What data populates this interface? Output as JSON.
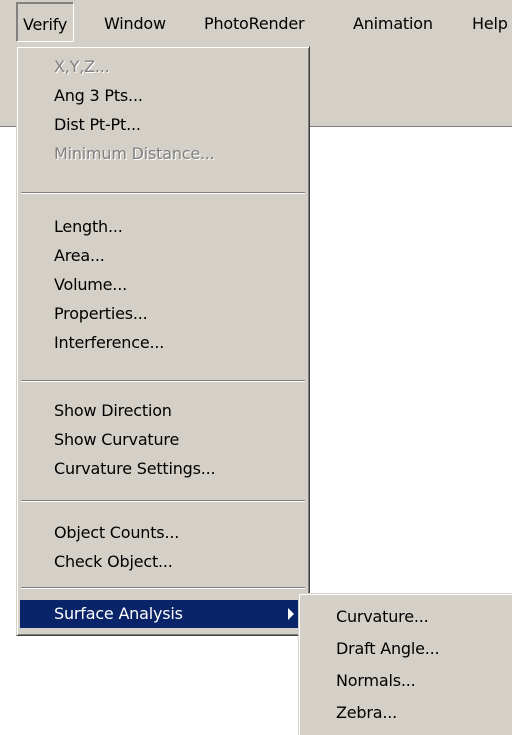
{
  "menubar": {
    "items": [
      {
        "label": "Verify",
        "active": true
      },
      {
        "label": "Window"
      },
      {
        "label": "PhotoRender"
      },
      {
        "label": "Animation"
      },
      {
        "label": "Help"
      }
    ]
  },
  "verify_menu": {
    "groups": [
      [
        {
          "label": "X,Y,Z...",
          "enabled": false
        },
        {
          "label": "Ang 3 Pts...",
          "enabled": true
        },
        {
          "label": "Dist Pt-Pt...",
          "enabled": true
        },
        {
          "label": "Minimum Distance...",
          "enabled": false
        }
      ],
      [
        {
          "label": "Length...",
          "enabled": true
        },
        {
          "label": "Area...",
          "enabled": true
        },
        {
          "label": "Volume...",
          "enabled": true
        },
        {
          "label": "Properties...",
          "enabled": true
        },
        {
          "label": "Interference...",
          "enabled": true
        }
      ],
      [
        {
          "label": "Show Direction",
          "enabled": true
        },
        {
          "label": "Show Curvature",
          "enabled": true
        },
        {
          "label": "Curvature Settings...",
          "enabled": true
        }
      ],
      [
        {
          "label": "Object Counts...",
          "enabled": true
        },
        {
          "label": "Check Object...",
          "enabled": true
        }
      ],
      [
        {
          "label": "Surface Analysis",
          "enabled": true,
          "selected": true,
          "submenu": true
        }
      ]
    ]
  },
  "surface_analysis_submenu": {
    "items": [
      {
        "label": "Curvature..."
      },
      {
        "label": "Draft Angle..."
      },
      {
        "label": "Normals..."
      },
      {
        "label": "Zebra..."
      }
    ]
  },
  "colors": {
    "menu_face": "#d4d0c8",
    "highlight": "#0a246a",
    "disabled_text": "#808080"
  }
}
